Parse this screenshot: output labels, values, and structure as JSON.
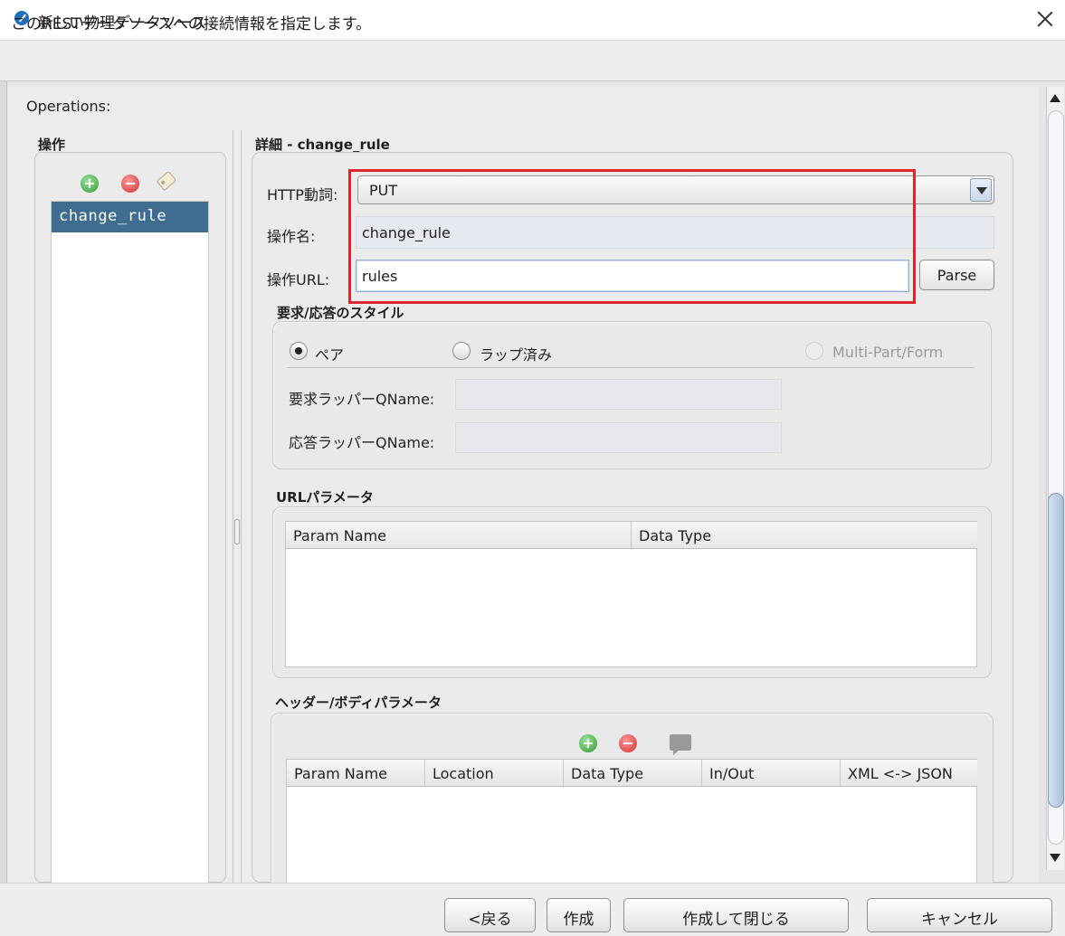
{
  "window": {
    "title": "新しい物理データソース",
    "close_icon": "close-icon"
  },
  "description": "このRESTデータソースへの接続情報を指定します。",
  "operations_label": "Operations:",
  "operations_list": {
    "title": "操作",
    "icons": [
      "add-icon",
      "remove-icon",
      "tag-icon"
    ],
    "items": [
      {
        "label": "change_rule",
        "selected": true
      }
    ]
  },
  "detail": {
    "title": "詳細 - change_rule",
    "http_verb_label": "HTTP動詞:",
    "http_verb_value": "PUT",
    "op_name_label": "操作名:",
    "op_name_value": "change_rule",
    "op_url_label": "操作URL:",
    "op_url_value": "rules",
    "parse_label": "Parse",
    "highlight_color": "#e0242e"
  },
  "style_section": {
    "title": "要求/応答のスタイル",
    "options": [
      {
        "label": "ペア",
        "selected": true,
        "enabled": true
      },
      {
        "label": "ラップ済み",
        "selected": false,
        "enabled": true
      },
      {
        "label": "Multi-Part/Form",
        "selected": false,
        "enabled": false
      }
    ],
    "request_wrapper_label": "要求ラッパーQName:",
    "request_wrapper_value": "",
    "response_wrapper_label": "応答ラッパーQName:",
    "response_wrapper_value": ""
  },
  "url_params": {
    "title": "URLパラメータ",
    "columns": [
      "Param Name",
      "Data Type"
    ],
    "rows": []
  },
  "header_body_params": {
    "title": "ヘッダー/ボディパラメータ",
    "icons": [
      "add-icon",
      "remove-icon",
      "comment-icon"
    ],
    "columns": [
      "Param Name",
      "Location",
      "Data Type",
      "In/Out",
      "XML <-> JSON"
    ],
    "rows": []
  },
  "footer": {
    "back": "<戻る",
    "create": "作成",
    "create_close": "作成して閉じる",
    "cancel": "キャンセル"
  }
}
